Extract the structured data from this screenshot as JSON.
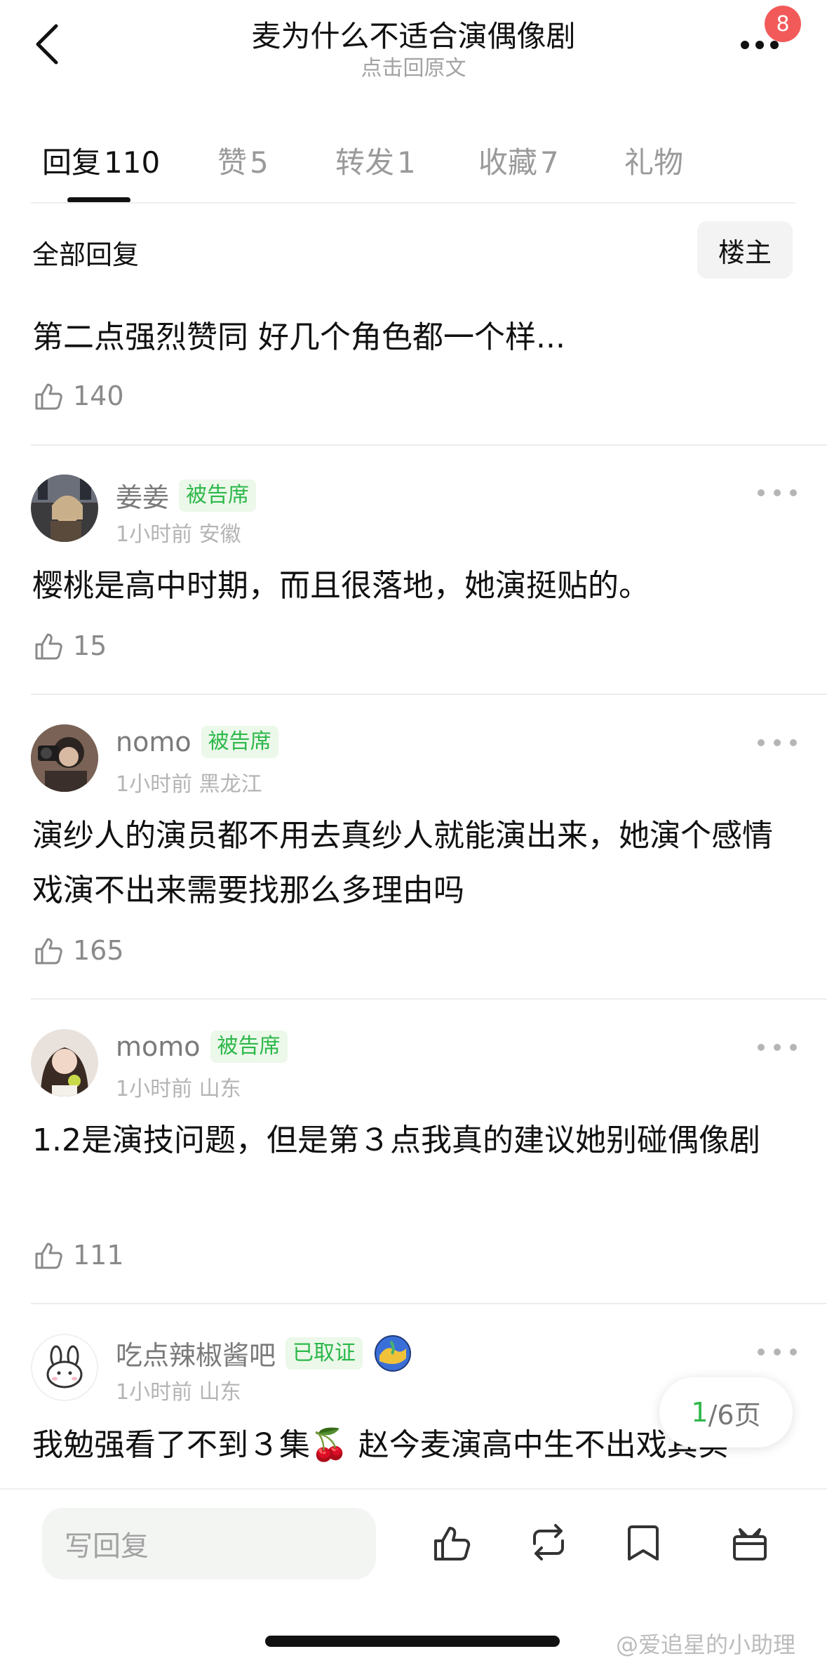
{
  "header": {
    "title": "麦为什么不适合演偶像剧",
    "subtitle": "点击回原文",
    "notification_count": "8"
  },
  "tabs": [
    {
      "label": "回复",
      "count": "110",
      "active": true
    },
    {
      "label": "赞",
      "count": "5"
    },
    {
      "label": "转发",
      "count": "1"
    },
    {
      "label": "收藏",
      "count": "7"
    },
    {
      "label": "礼物",
      "count": ""
    }
  ],
  "section": {
    "title": "全部回复",
    "owner_button": "楼主"
  },
  "top_comment": {
    "text": "第二点强烈赞同 好几个角色都一个样...",
    "likes": "140"
  },
  "comments": [
    {
      "name": "姜姜",
      "tag": "被告席",
      "time": "1小时前",
      "location": "安徽",
      "text": "樱桃是高中时期，而且很落地，她演挺贴的。",
      "likes": "15"
    },
    {
      "name": "nomo",
      "tag": "被告席",
      "time": "1小时前",
      "location": "黑龙江",
      "text": "演纱人的演员都不用去真纱人就能演出来，她演个感情戏演不出来需要找那么多理由吗",
      "likes": "165"
    },
    {
      "name": "momo",
      "tag": "被告席",
      "time": "1小时前",
      "location": "山东",
      "text": "1.2是演技问题，但是第３点我真的建议她别碰偶像剧",
      "likes": "111"
    },
    {
      "name": "吃点辣椒酱吧",
      "tag": "已取证",
      "time": "1小时前",
      "location": "山东",
      "text": "我勉强看了不到３集🍒 赵今麦演高中生不出戏其实",
      "likes": ""
    }
  ],
  "pagination": {
    "current": "1",
    "total": "/6页"
  },
  "bottom_bar": {
    "reply_placeholder": "写回复",
    "icons": [
      "like-icon",
      "repost-icon",
      "bookmark-icon",
      "gift-icon"
    ]
  },
  "watermark": "@爱追星的小助理",
  "colors": {
    "accent_green": "#2db84a",
    "tag_bg": "#ecf8ea",
    "badge_red": "#f25a5a"
  }
}
